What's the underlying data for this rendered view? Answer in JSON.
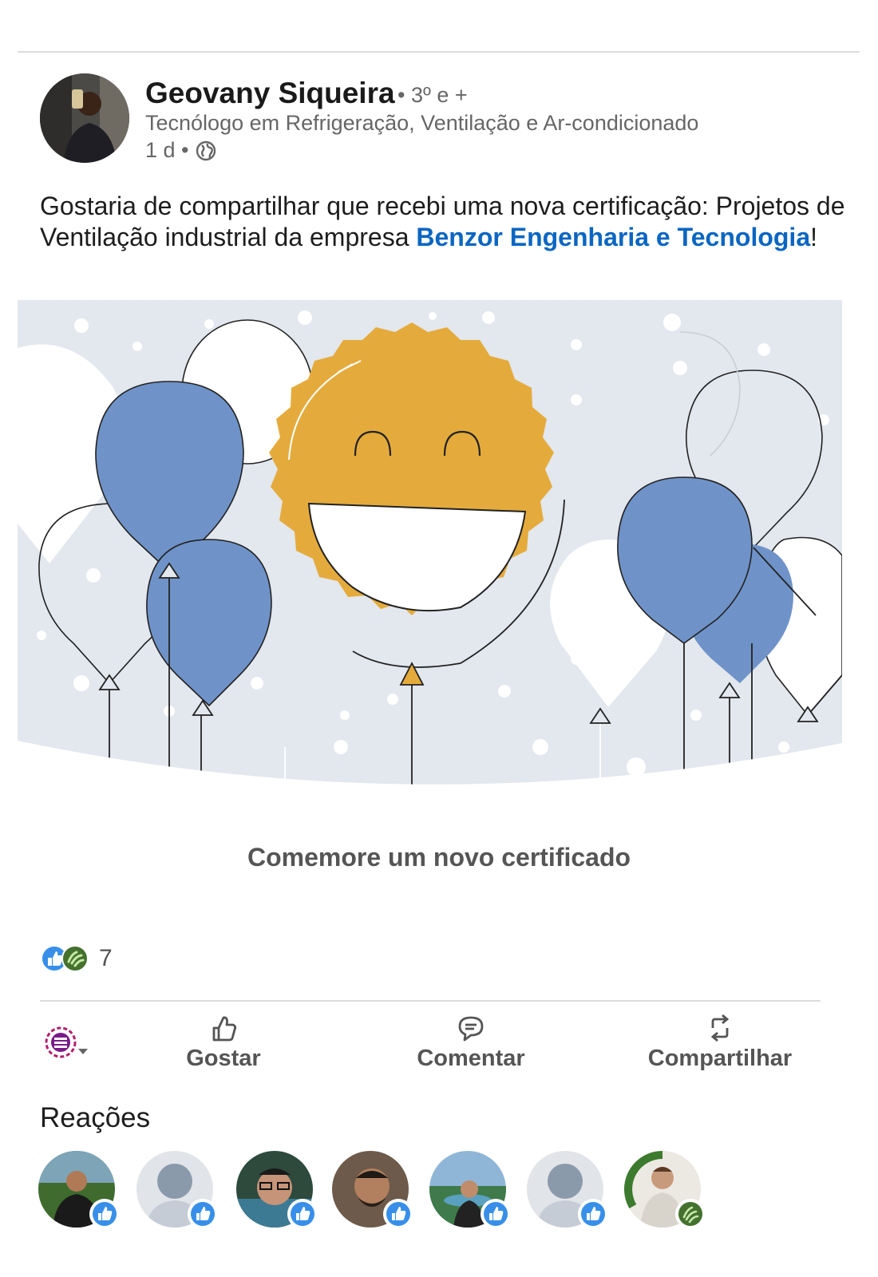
{
  "post": {
    "author": {
      "name": "Geovany Siqueira",
      "degree": "• 3º e +",
      "headline": "Tecnólogo em Refrigeração, Ventilação e Ar-condicionado",
      "time": "1 d •"
    },
    "text_before_link": "Gostaria de compartilhar que recebi uma nova certificação: Projetos de Ventilação industrial da empresa ",
    "link_text": "Benzor Engenharia e Tecnologia",
    "text_after_link": "!",
    "banner_caption": "Comemore um novo certificado",
    "reaction_count": "7"
  },
  "actions": {
    "like": "Gostar",
    "comment": "Comentar",
    "share": "Compartilhar"
  },
  "reactions_section": {
    "title": "Reações"
  },
  "reactors": [
    {
      "type": "photo",
      "badge": "like-icon"
    },
    {
      "type": "placeholder",
      "badge": "like-icon"
    },
    {
      "type": "photo",
      "badge": "like-icon"
    },
    {
      "type": "photo",
      "badge": "like-icon"
    },
    {
      "type": "photo",
      "badge": "like-icon"
    },
    {
      "type": "placeholder",
      "badge": "like-icon"
    },
    {
      "type": "photo",
      "badge": "celebrate-icon"
    }
  ],
  "colors": {
    "link": "#0a66c2",
    "like_badge": "#378fe9",
    "celebrate_badge": "#44712e",
    "balloon_blue": "#6f93c8",
    "smiley_gold": "#e4ab3c",
    "banner_bg": "#e3e7ee"
  }
}
